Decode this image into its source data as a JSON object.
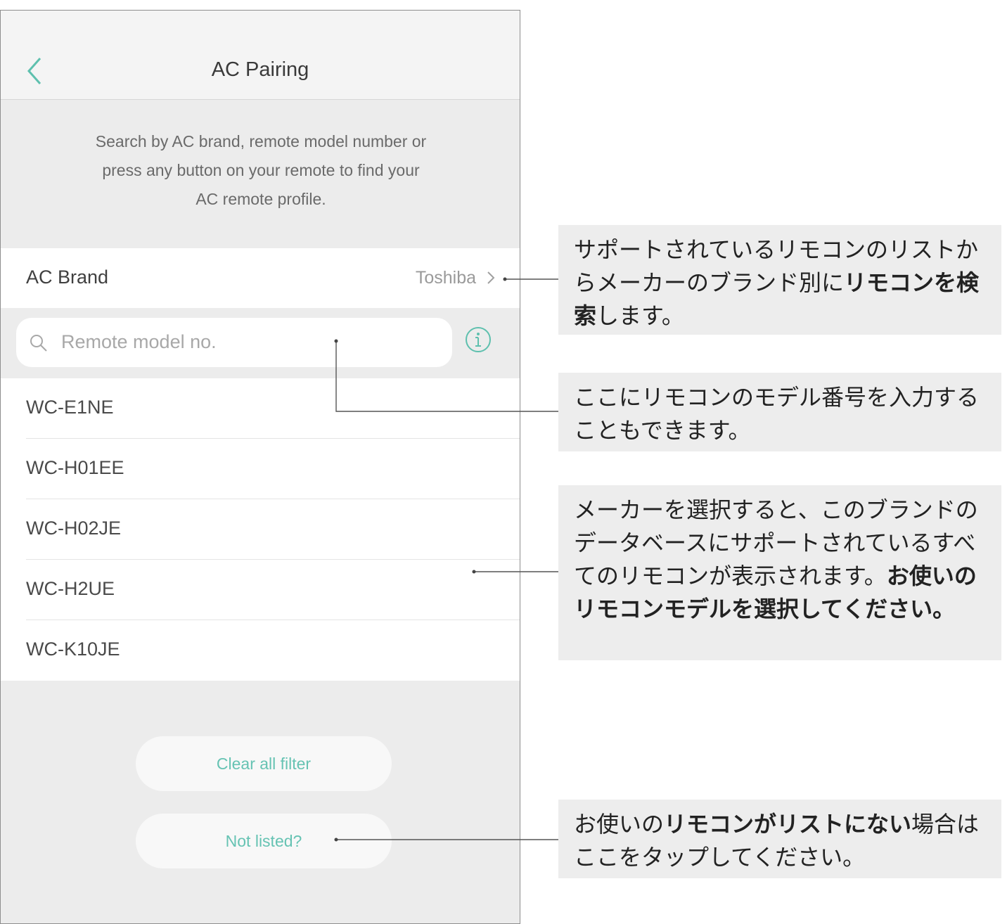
{
  "app": {
    "title": "AC Pairing",
    "accent_color": "#5ec0ae"
  },
  "instructions": {
    "line1": "Search by AC brand, remote model number or",
    "line2": "press any button on your remote to find your",
    "line3": "AC remote profile."
  },
  "brand_row": {
    "label": "AC Brand",
    "value": "Toshiba",
    "icon": "chevron-right-icon"
  },
  "search": {
    "placeholder": "Remote model no.",
    "icon": "search-icon",
    "info_icon": "info-icon"
  },
  "models": [
    {
      "label": "WC-E1NE"
    },
    {
      "label": "WC-H01EE"
    },
    {
      "label": "WC-H02JE"
    },
    {
      "label": "WC-H2UE"
    },
    {
      "label": "WC-K10JE"
    }
  ],
  "buttons": {
    "clear": "Clear all filter",
    "not_listed": "Not listed?"
  },
  "callouts": {
    "brand": {
      "p1": "サポートされているリモコンのリストからメーカーのブランド別に",
      "b1": "リモコンを検索",
      "p2": "します。"
    },
    "search": {
      "p1": "ここにリモコンのモデル番号を入力することもできます。"
    },
    "list": {
      "p1": "メーカーを選択すると、このブランドのデータベースにサポートされているすべてのリモコンが表示されます。",
      "b1": "お使いのリモコンモデルを選択してください。"
    },
    "notlisted": {
      "p1": "お使いの",
      "b1": "リモコンがリストにない",
      "p2": "場合はここをタップしてください。"
    }
  }
}
